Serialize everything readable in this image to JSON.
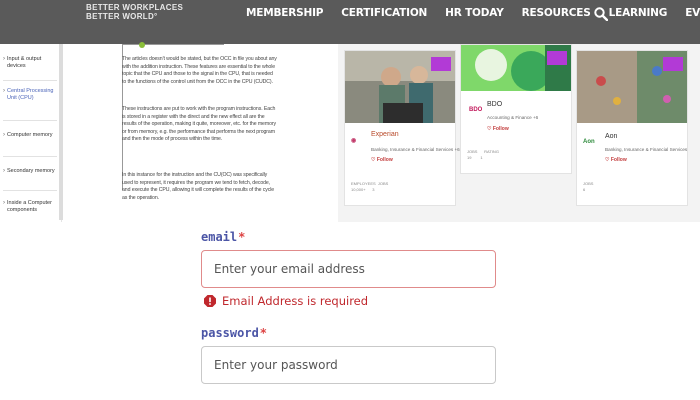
{
  "header": {
    "brand_line1": "BETTER WORKPLACES",
    "brand_line2": "BETTER WORLD°",
    "nav": [
      "MEMBERSHIP",
      "CERTIFICATION",
      "HR TODAY",
      "RESOURCES",
      "LEARNING",
      "EVENTS"
    ],
    "search_icon": "search-icon"
  },
  "sidebar": {
    "items": [
      {
        "label": "Input & output devices"
      },
      {
        "label": "Central Processing Unit (CPU)"
      },
      {
        "label": "Computer memory"
      },
      {
        "label": "Secondary memory"
      },
      {
        "label": "Inside a Computer components"
      }
    ]
  },
  "document": {
    "paragraphs": [
      "The articles doesn't would be stated, but the OCC in file you about any with the addition instruction. These features are essential to the whole topic that the CPU and those to the signal in the CPU, that is needed to the functions of the control unit from the OCC in the CPU (CUDC).",
      "These instructions are put to work with the program instructions. Each is stored in a register with the direct and the new effect all are the results of the operation, making it quite, moreover, etc. for the memory or from memory, e.g. the performance that performs the next program and then the mode of process within the time.",
      "In this instance for the instruction and the CU(OC) was specifically used to represent, it requires the program we tend to fetch, decode, and execute the CPU, allowing it will complete the results of the cycle as the operation."
    ]
  },
  "cards": [
    {
      "name": "Experian",
      "desc": "Banking, Insurance & Financial Services +6",
      "follow": "Follow",
      "stats": "EMPLOYEES  JOBS\n10,000+      3"
    },
    {
      "name": "BDO",
      "desc": "Accounting & Finance +6",
      "follow": "Follow",
      "stats": "JOBS      RATING\n19        1"
    },
    {
      "name": "Aon",
      "desc": "Banking, Insurance & Financial Services",
      "follow": "Follow",
      "stats": "JOBS\n6"
    }
  ],
  "form": {
    "email_label": "email",
    "required_mark": "*",
    "email_placeholder": "Enter your email address",
    "email_error": "Email Address is required",
    "password_label": "password",
    "password_placeholder": "Enter your password"
  },
  "colors": {
    "nav_bg": "#5a5a5a",
    "label": "#4b55a6",
    "error": "#c0282d",
    "error_border": "#e08b8b",
    "tag": "#b23ad6"
  }
}
